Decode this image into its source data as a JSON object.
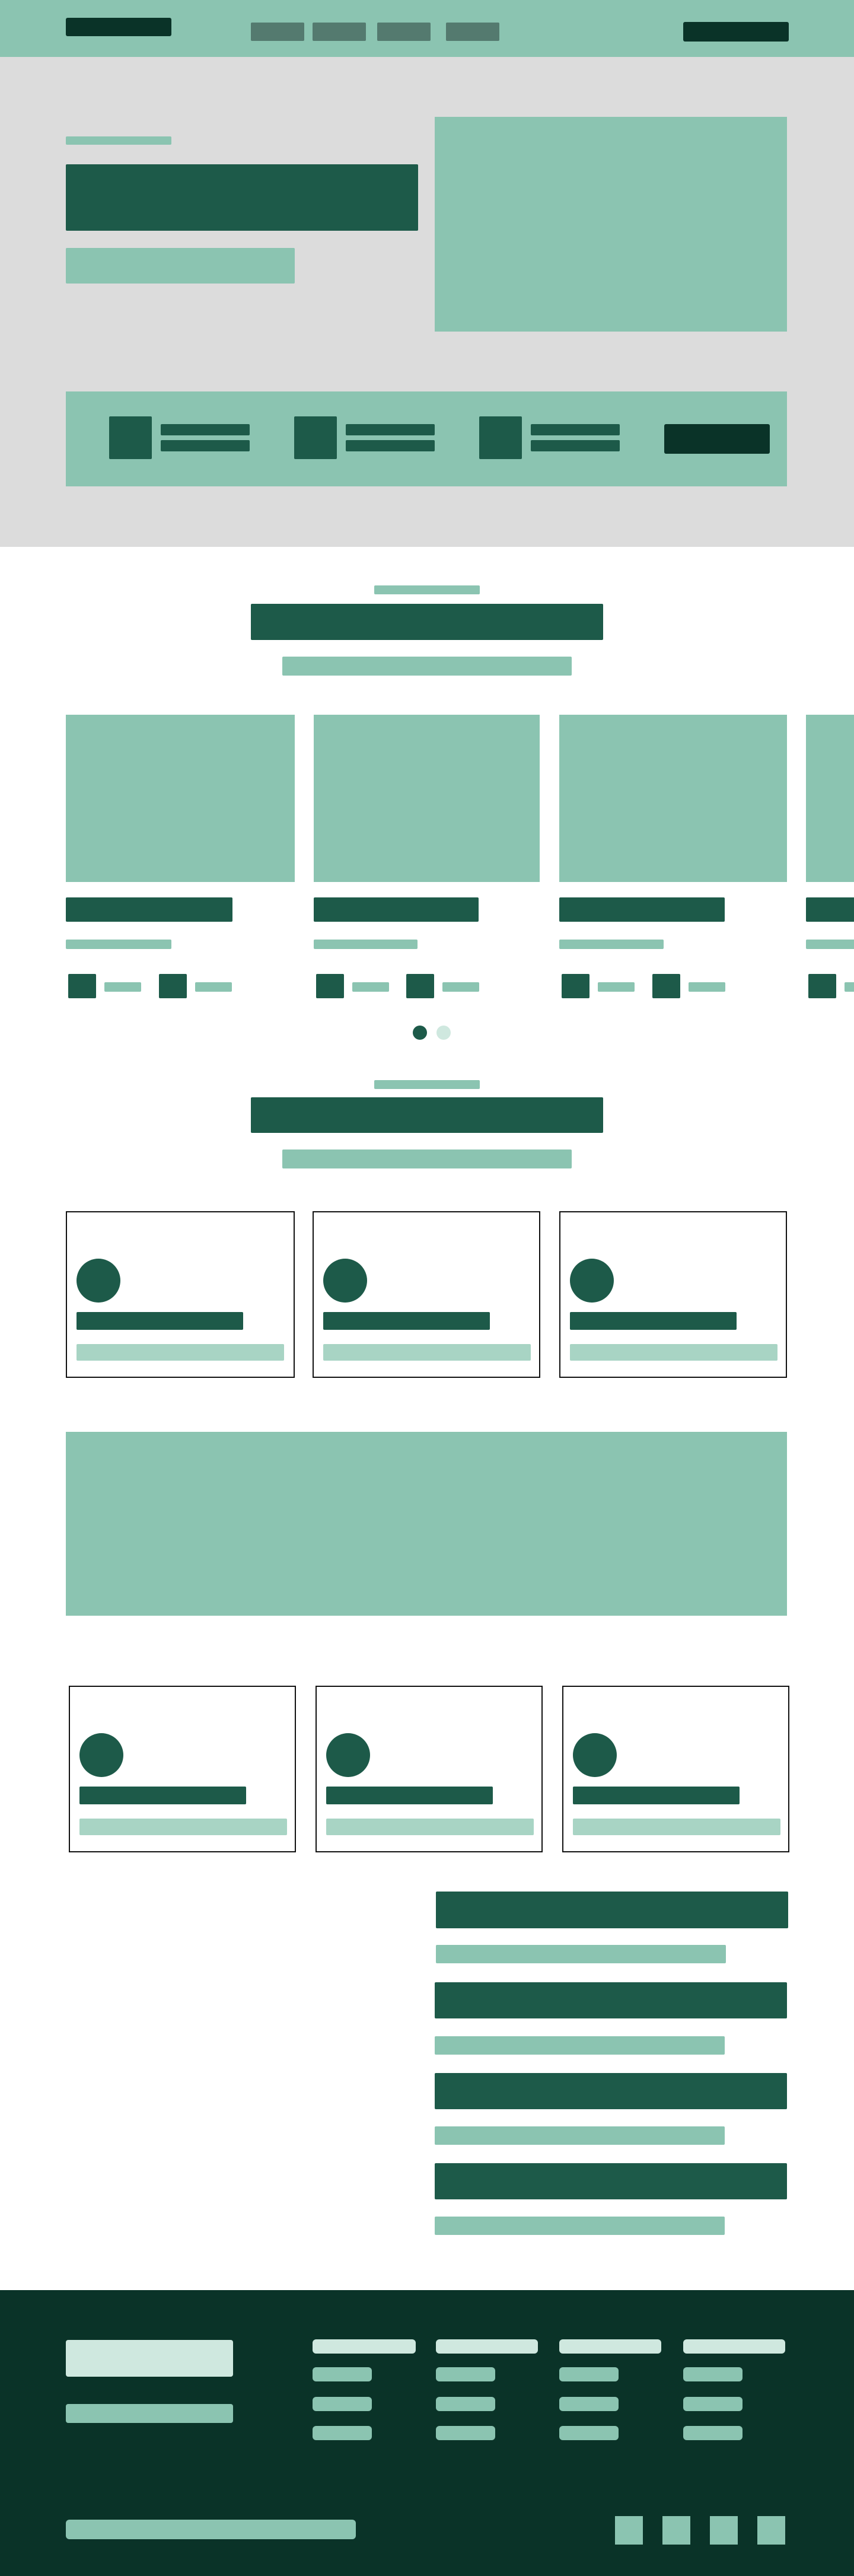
{
  "colors": {
    "mint": "#8bc4b1",
    "mint_light": "#a8d4c4",
    "mint_pale": "#cfe8df",
    "dark_green": "#1d5a49",
    "darkest_green": "#0a3328",
    "nav_gray": "#547a6f",
    "hero_background": "#dcdcdc"
  },
  "header": {
    "logo_icon": "logo-placeholder",
    "nav_items": [
      "",
      "",
      "",
      ""
    ],
    "cta_icon": "button-placeholder"
  },
  "hero": {
    "media_icon": "image-placeholder",
    "features": [
      {
        "icon": "feature-icon-placeholder"
      },
      {
        "icon": "feature-icon-placeholder"
      },
      {
        "icon": "feature-icon-placeholder"
      }
    ]
  },
  "carousel": {
    "pagination": {
      "dots": 2,
      "active": 1
    }
  },
  "footer": {
    "column_count": 4,
    "social_icons": [
      "social-icon",
      "social-icon",
      "social-icon",
      "social-icon"
    ]
  }
}
